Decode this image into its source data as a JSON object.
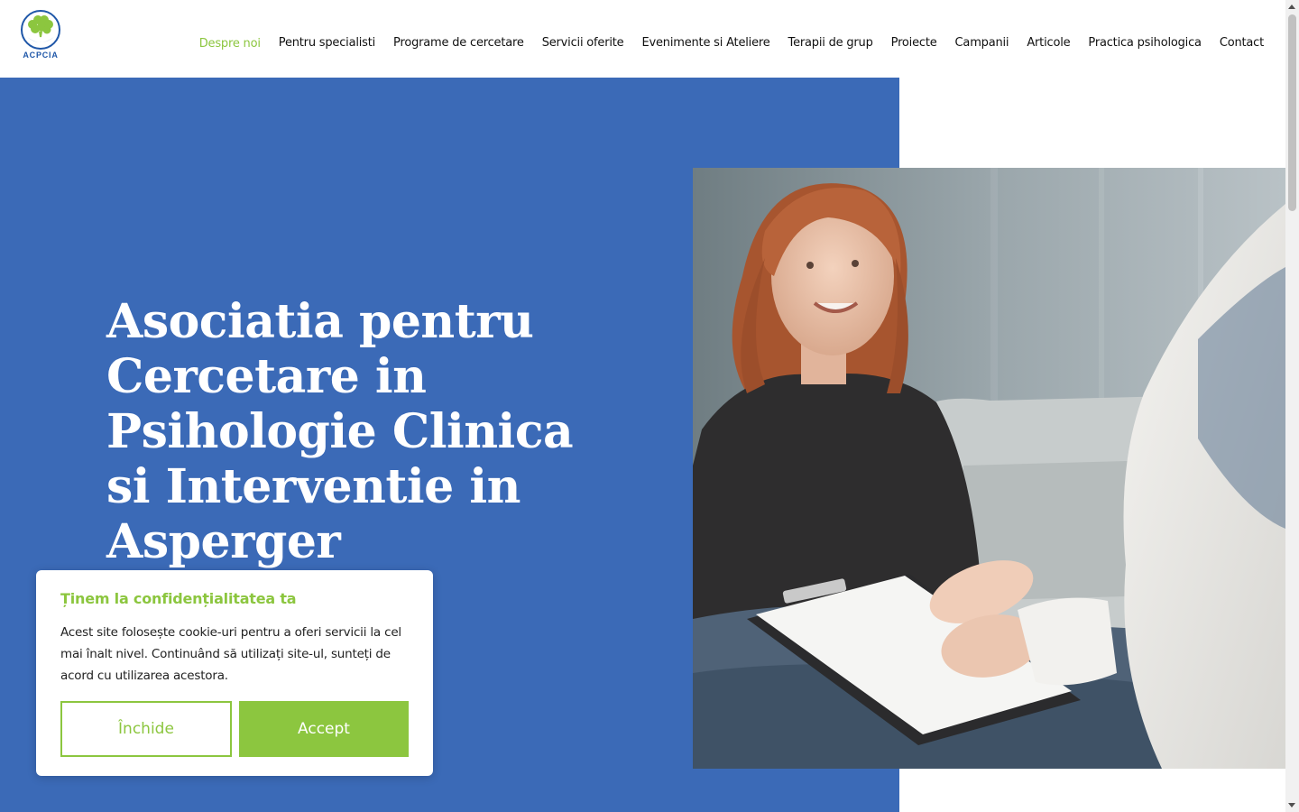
{
  "brand": {
    "logo_text": "ACPCIA",
    "colors": {
      "blue": "#3b6ab7",
      "green": "#8cc63f",
      "logo_blue": "#1f57a8"
    }
  },
  "nav": {
    "items": [
      {
        "label": "Despre noi",
        "active": true
      },
      {
        "label": "Pentru specialisti"
      },
      {
        "label": "Programe de cercetare"
      },
      {
        "label": "Servicii oferite"
      },
      {
        "label": "Evenimente si Ateliere"
      },
      {
        "label": "Terapii de grup"
      },
      {
        "label": "Proiecte"
      },
      {
        "label": "Campanii"
      },
      {
        "label": "Articole"
      },
      {
        "label": "Practica psihologica"
      },
      {
        "label": "Contact"
      }
    ]
  },
  "hero": {
    "title": "Asociatia pentru Cercetare in Psihologie Clinica si Interventie in Asperger",
    "image_icon": "photo-therapy-session"
  },
  "cookie": {
    "title": "Ținem la confidențialitatea ta",
    "text": "Acest site folosește cookie-uri pentru a oferi servicii la cel mai înalt nivel. Continuând să utilizați site-ul, sunteți de acord cu utilizarea acestora.",
    "close_label": "Închide",
    "accept_label": "Accept"
  }
}
